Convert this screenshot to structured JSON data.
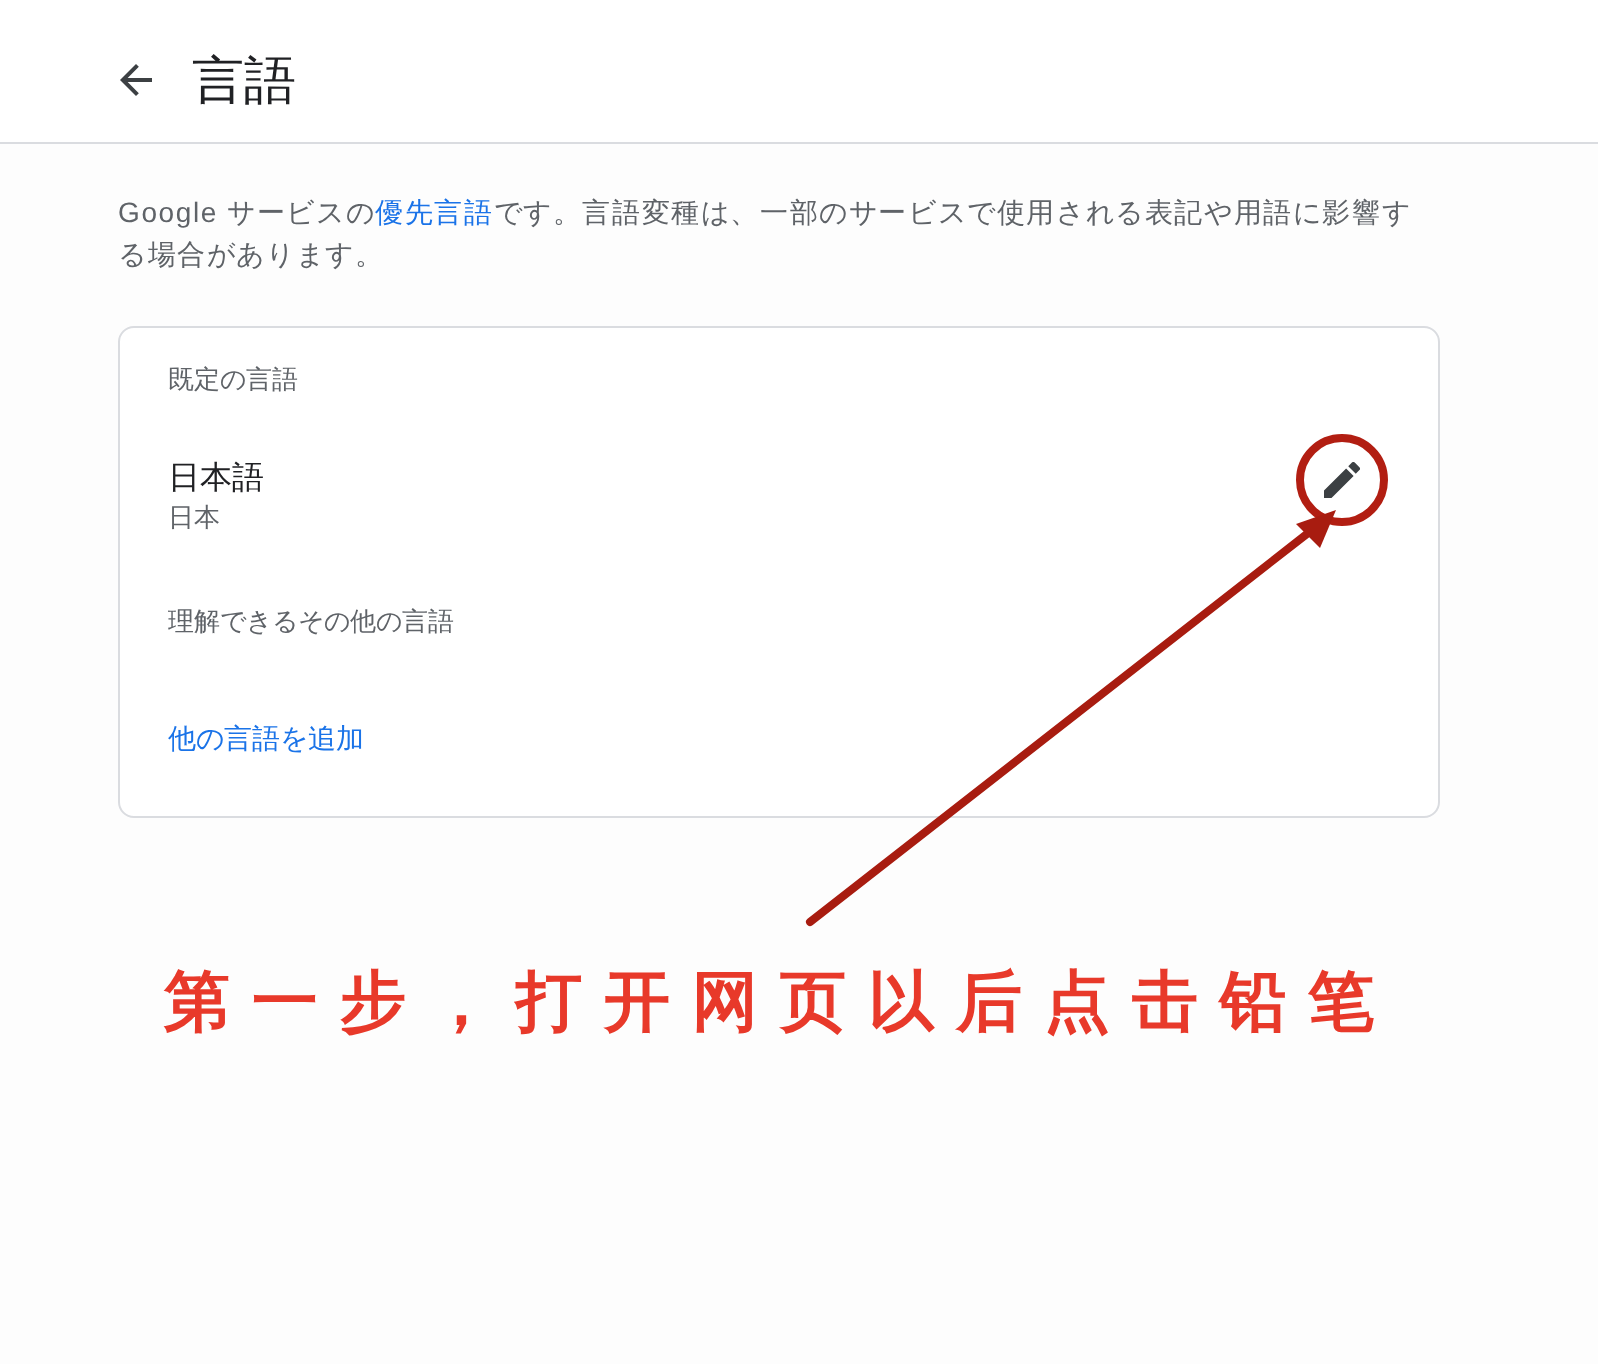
{
  "header": {
    "title": "言語"
  },
  "description": {
    "before": "Google サービスの",
    "link": "優先言語",
    "after": "です。言語変種は、一部のサービスで使用される表記や用語に影響する場合があります。"
  },
  "card": {
    "default_language": {
      "heading": "既定の言語",
      "language": "日本語",
      "region": "日本"
    },
    "other_languages": {
      "heading": "理解できるその他の言語",
      "add_link": "他の言語を追加"
    }
  },
  "annotation": {
    "caption": "第一步，打开网页以后点击铅笔"
  }
}
